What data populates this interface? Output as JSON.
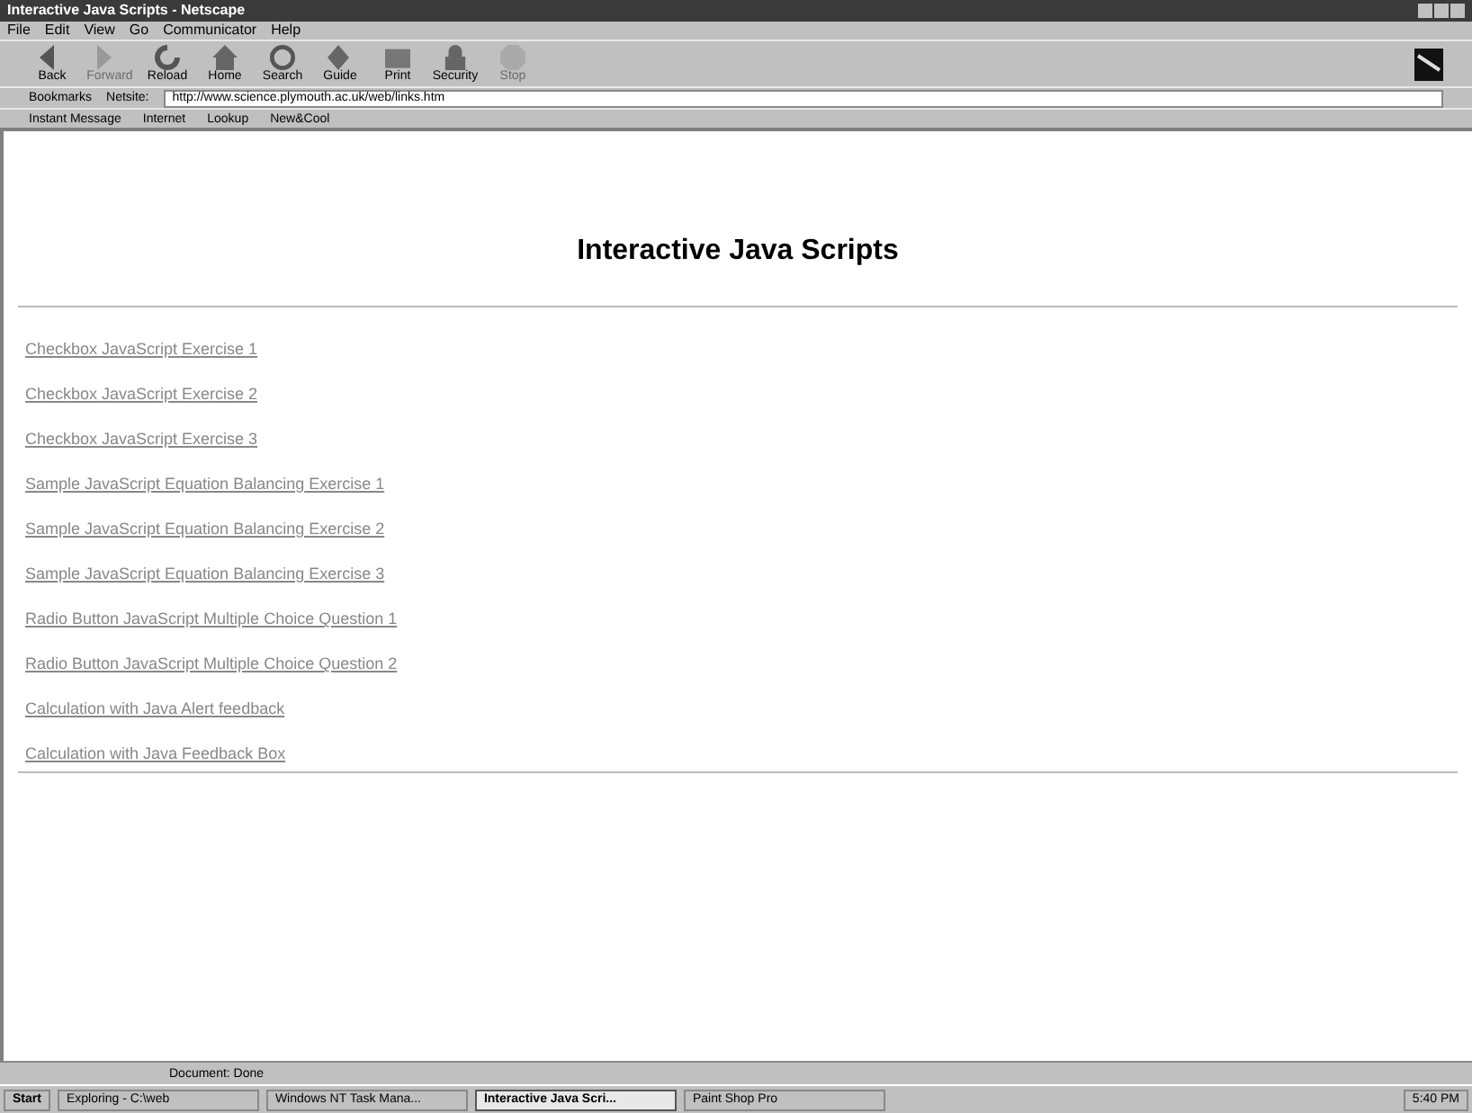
{
  "window": {
    "title": "Interactive Java Scripts - Netscape"
  },
  "menu": [
    "File",
    "Edit",
    "View",
    "Go",
    "Communicator",
    "Help"
  ],
  "toolbar": [
    {
      "label": "Back",
      "disabled": false
    },
    {
      "label": "Forward",
      "disabled": true
    },
    {
      "label": "Reload",
      "disabled": false
    },
    {
      "label": "Home",
      "disabled": false
    },
    {
      "label": "Search",
      "disabled": false
    },
    {
      "label": "Guide",
      "disabled": false
    },
    {
      "label": "Print",
      "disabled": false
    },
    {
      "label": "Security",
      "disabled": false
    },
    {
      "label": "Stop",
      "disabled": true
    }
  ],
  "location": {
    "bookmarks": "Bookmarks",
    "label": "Netsite:",
    "value": "http://www.science.plymouth.ac.uk/web/links.htm"
  },
  "personal_toolbar": [
    "Instant Message",
    "Internet",
    "Lookup",
    "New&Cool"
  ],
  "page": {
    "heading": "Interactive Java Scripts",
    "links": [
      "Checkbox JavaScript Exercise 1",
      "Checkbox JavaScript Exercise 2",
      "Checkbox JavaScript Exercise 3",
      "Sample JavaScript Equation Balancing Exercise 1",
      "Sample JavaScript Equation Balancing Exercise 2",
      "Sample JavaScript Equation Balancing Exercise 3",
      "Radio Button JavaScript Multiple Choice Question 1",
      "Radio Button JavaScript Multiple Choice Question 2",
      "Calculation with Java Alert feedback",
      "Calculation with Java Feedback Box"
    ]
  },
  "status_bar": {
    "text": "Document: Done"
  },
  "taskbar": {
    "start": "Start",
    "tasks": [
      {
        "label": "Exploring - C:\\web",
        "selected": false
      },
      {
        "label": "Windows NT Task Mana...",
        "selected": false
      },
      {
        "label": "Interactive Java Scri...",
        "selected": true
      },
      {
        "label": "Paint Shop Pro",
        "selected": false
      }
    ],
    "clock": "5:40 PM"
  }
}
